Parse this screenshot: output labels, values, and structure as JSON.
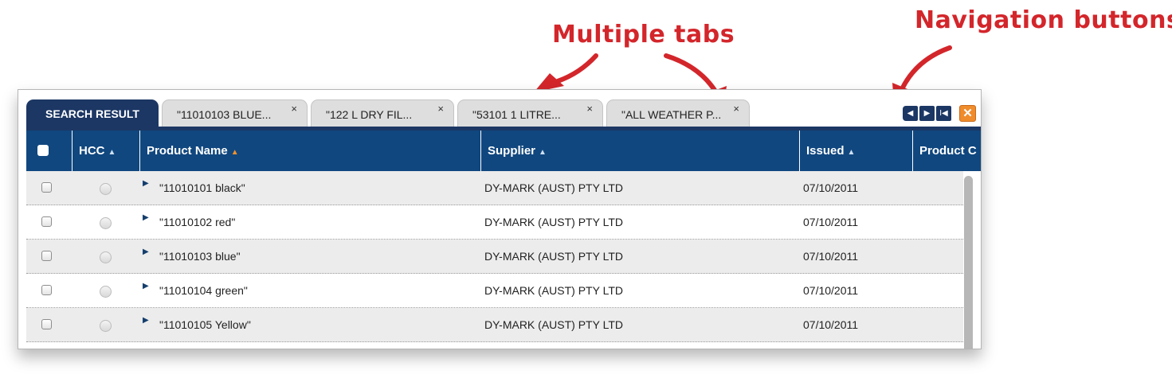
{
  "annotations": {
    "tabs_label": "Multiple tabs",
    "nav_label": "Navigation buttons",
    "color": "#d3262b"
  },
  "tabs": [
    {
      "label": "SEARCH RESULT",
      "active": true
    },
    {
      "label": "\"11010103 BLUE...",
      "close": "×"
    },
    {
      "label": "\"122 L DRY FIL...",
      "close": "×"
    },
    {
      "label": "\"53101 1 LITRE...",
      "close": "×"
    },
    {
      "label": "\"ALL WEATHER P...",
      "close": "×"
    }
  ],
  "nav_buttons": {
    "prev_icon": "◀",
    "next_icon": "▶",
    "first_icon": "I◀",
    "close_icon": "✕"
  },
  "columns": {
    "hcc": "HCC",
    "product_name": "Product Name",
    "supplier": "Supplier",
    "issued": "Issued",
    "product_code": "Product C",
    "sort_icon": "▲"
  },
  "rows": [
    {
      "name": "\"11010101 black\"",
      "supplier": "DY-MARK (AUST) PTY LTD",
      "issued": "07/10/2011"
    },
    {
      "name": "\"11010102 red\"",
      "supplier": "DY-MARK (AUST) PTY LTD",
      "issued": "07/10/2011"
    },
    {
      "name": "\"11010103 blue\"",
      "supplier": "DY-MARK (AUST) PTY LTD",
      "issued": "07/10/2011"
    },
    {
      "name": "\"11010104 green\"",
      "supplier": "DY-MARK (AUST) PTY LTD",
      "issued": "07/10/2011"
    },
    {
      "name": "\"11010105 Yellow\"",
      "supplier": "DY-MARK (AUST) PTY LTD",
      "issued": "07/10/2011"
    }
  ],
  "colors": {
    "navy": "#1c3764",
    "header_blue": "#10477f",
    "sort_active": "#f0922c",
    "close_orange": "#ef8c2b"
  }
}
